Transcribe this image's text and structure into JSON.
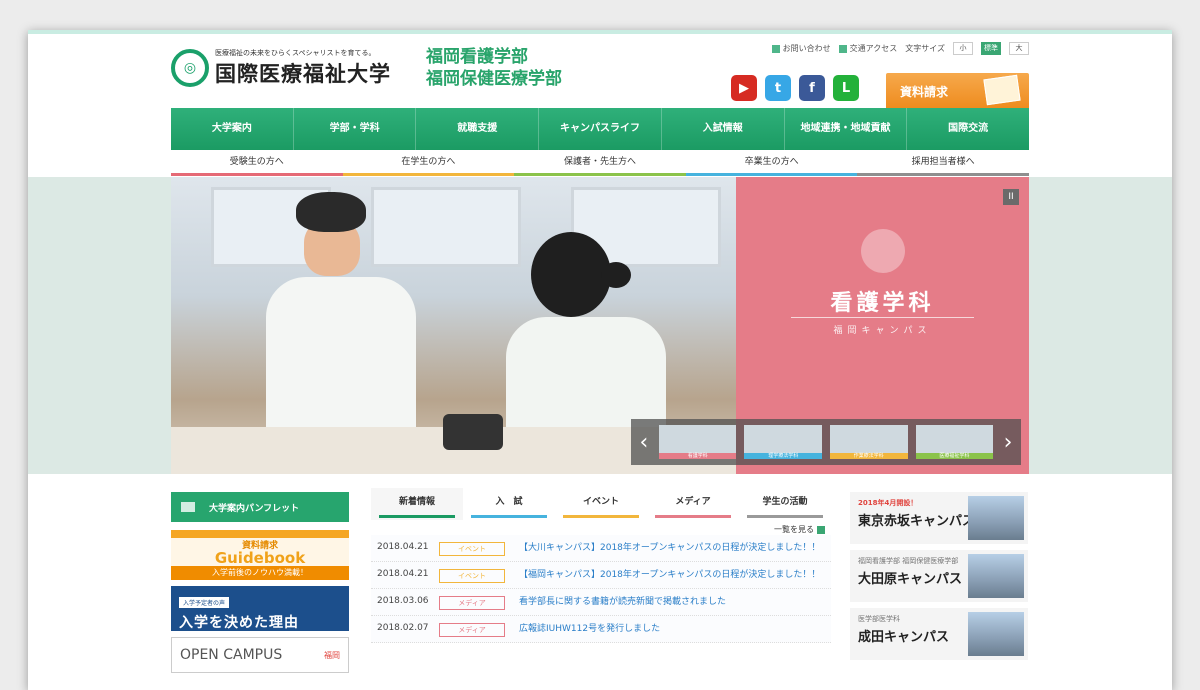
{
  "header": {
    "tagline": "医療福祉の未来をひらくスペシャリストを育てる。",
    "university": "国際医療福祉大学",
    "faculty_lines": [
      "福岡看護学部",
      "福岡保健医療学部"
    ],
    "util_links": [
      "お問い合わせ",
      "交通アクセス"
    ],
    "font_size_label": "文字サイズ",
    "font_sizes": [
      "小",
      "標準",
      "大"
    ],
    "request_button": "資料請求"
  },
  "social": [
    {
      "name": "youtube",
      "glyph": "▶",
      "color": "#d62b22"
    },
    {
      "name": "twitter",
      "glyph": "t",
      "color": "#37a7e6"
    },
    {
      "name": "facebook",
      "glyph": "f",
      "color": "#3b5998"
    },
    {
      "name": "line",
      "glyph": "L",
      "color": "#23b13a"
    }
  ],
  "nav": [
    "大学案内",
    "学部・学科",
    "就職支援",
    "キャンパスライフ",
    "入試情報",
    "地域連携・地域貢献",
    "国際交流"
  ],
  "subnav": [
    "受験生の方へ",
    "在学生の方へ",
    "保護者・先生方へ",
    "卒業生の方へ",
    "採用担当者様へ"
  ],
  "hero": {
    "title": "看護学科",
    "subtitle": "福岡キャンパス",
    "pause": "II",
    "prev": "‹",
    "next": "›",
    "thumb_captions": [
      "看護学科",
      "理学療法学科",
      "作業療法学科",
      "医療福祉学科"
    ]
  },
  "left": {
    "pamphlet": "大学案内パンフレット",
    "guide_l1": "資料請求",
    "guide_l2": "Guidebook",
    "guide_l3": "入学前後のノウハウ満載！",
    "decide_tag": "入学予定者の声",
    "decide_big": "入学を決めた理由",
    "open_campus": "OPEN CAMPUS",
    "open_campus_badge": "福岡"
  },
  "news": {
    "tabs": [
      "新着情報",
      "入　試",
      "イベント",
      "メディア",
      "学生の活動"
    ],
    "list_all": "一覧を見る",
    "items": [
      {
        "date": "2018.04.21",
        "cat": "イベント",
        "media": false,
        "text": "【大川キャンパス】2018年オープンキャンパスの日程が決定しました！！"
      },
      {
        "date": "2018.04.21",
        "cat": "イベント",
        "media": false,
        "text": "【福岡キャンパス】2018年オープンキャンパスの日程が決定しました！！"
      },
      {
        "date": "2018.03.06",
        "cat": "メディア",
        "media": true,
        "text": "看学部長に関する書籍が読売新聞で掲載されました"
      },
      {
        "date": "2018.02.07",
        "cat": "メディア",
        "media": true,
        "text": "広報誌IUHW112号を発行しました"
      }
    ]
  },
  "campuses": [
    {
      "small": "2018年4月開設！",
      "small_red": true,
      "name": "東京赤坂キャンパス"
    },
    {
      "small": "福岡看護学部 福岡保健医療学部",
      "small_red": false,
      "name": "大田原キャンパス"
    },
    {
      "small": "医学部医学科",
      "small_red": false,
      "name": "成田キャンパス"
    }
  ]
}
